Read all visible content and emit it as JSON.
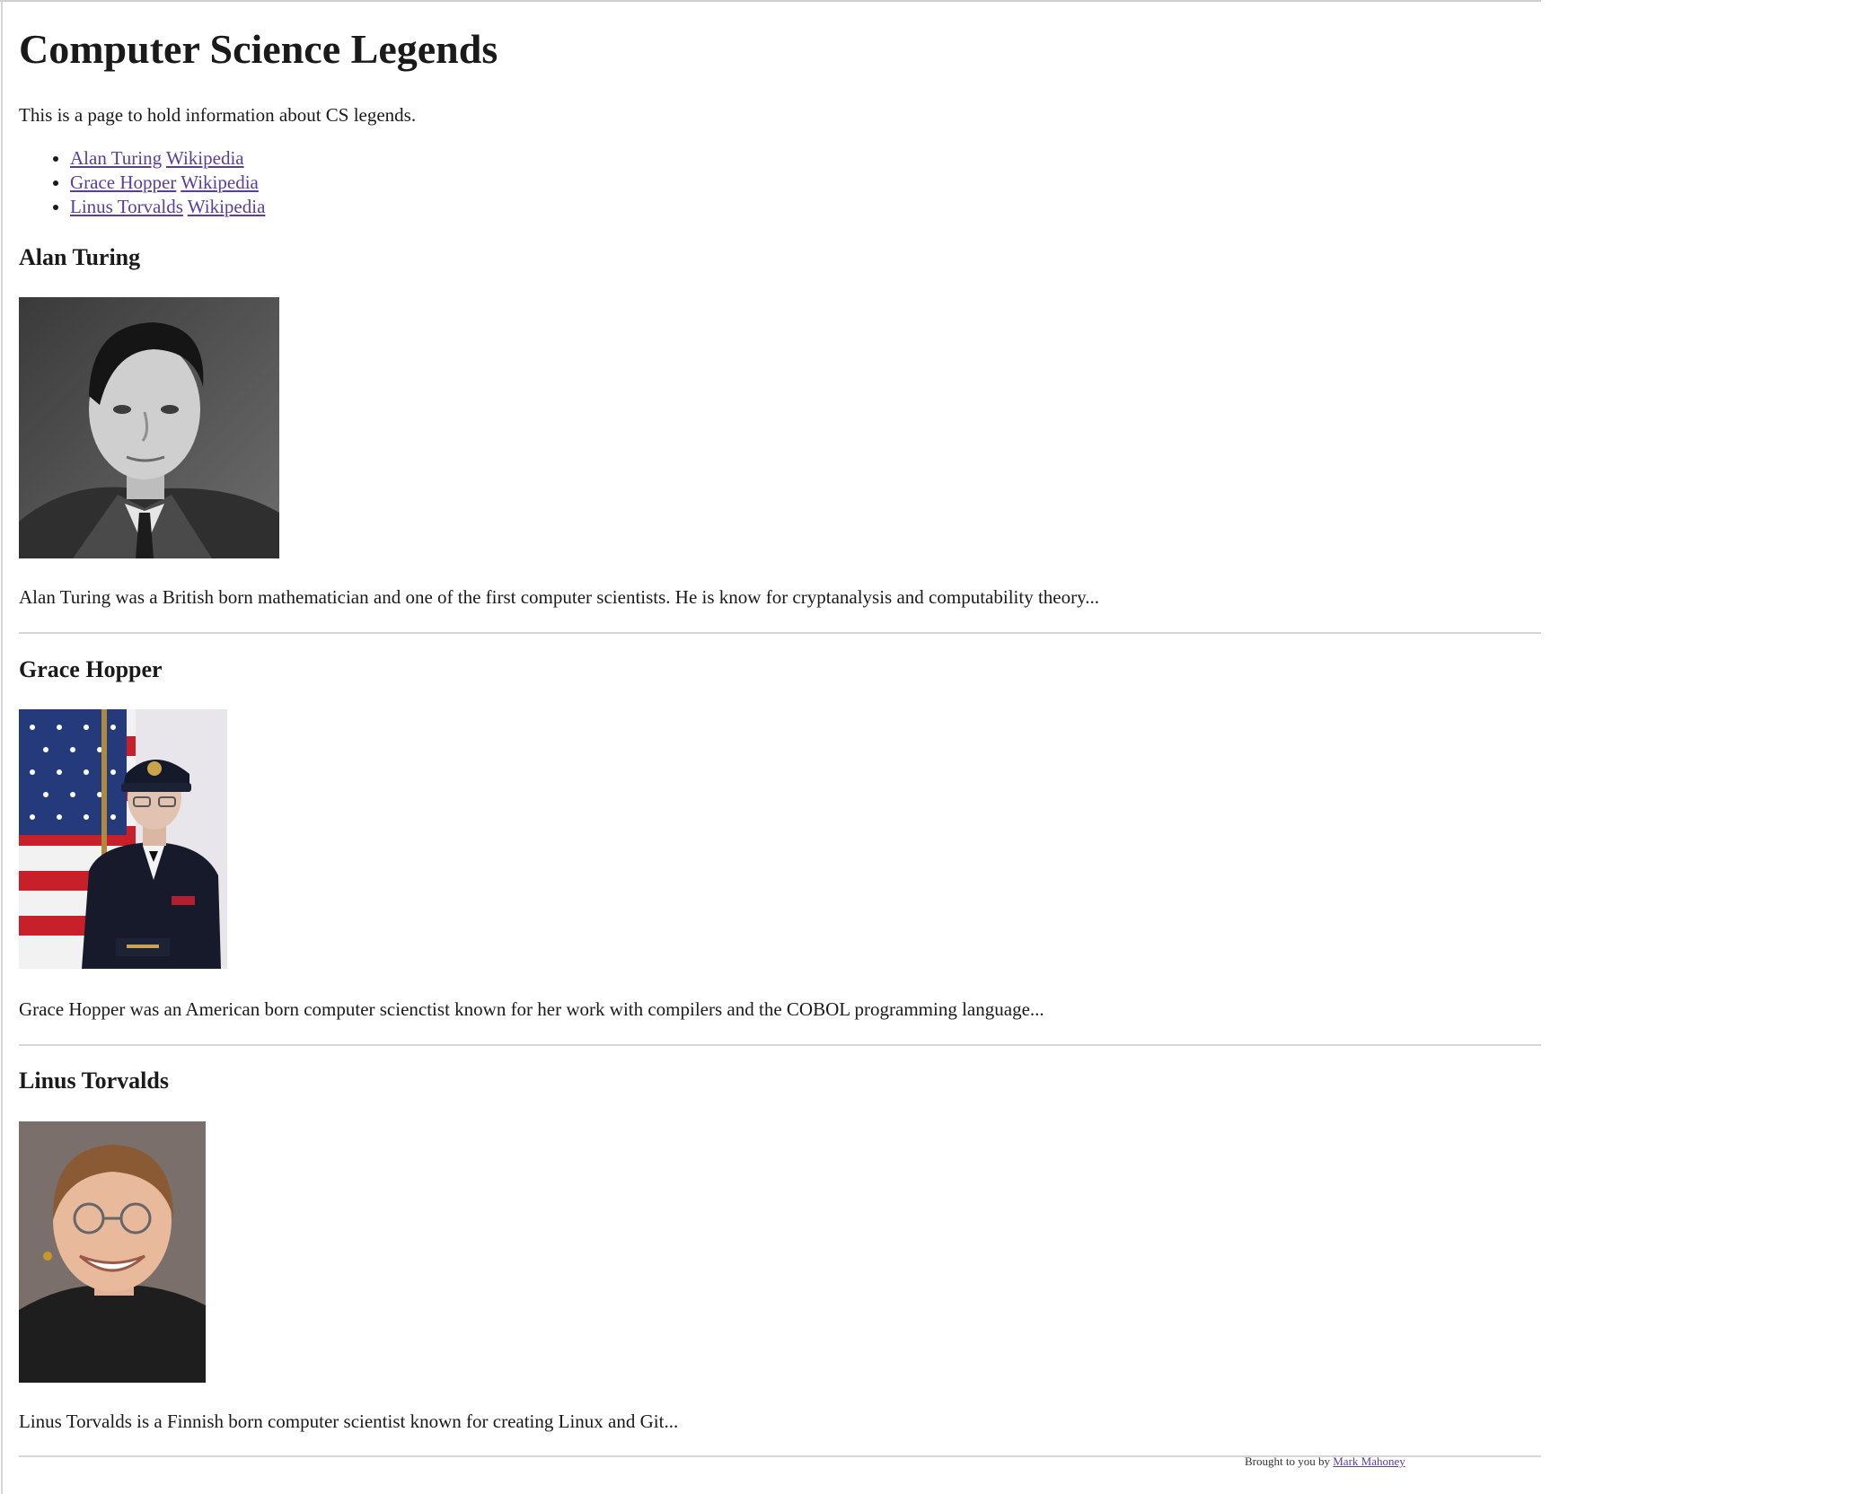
{
  "page": {
    "title": "Computer Science Legends",
    "intro": "This is a page to hold information about CS legends."
  },
  "toc": [
    {
      "name": "Alan Turing",
      "wiki": "Wikipedia"
    },
    {
      "name": "Grace Hopper",
      "wiki": "Wikipedia"
    },
    {
      "name": "Linus Torvalds",
      "wiki": "Wikipedia"
    }
  ],
  "sections": [
    {
      "heading": "Alan Turing",
      "bio": "Alan Turing was a British born mathematician and one of the first computer scientists. He is know for cryptanalysis and computability theory..."
    },
    {
      "heading": "Grace Hopper",
      "bio": "Grace Hopper was an American born computer scienctist known for her work with compilers and the COBOL programming language..."
    },
    {
      "heading": "Linus Torvalds",
      "bio": "Linus Torvalds is a Finnish born computer scientist known for creating Linux and Git..."
    }
  ],
  "footer": {
    "prefix": "Brought to you by",
    "author_link": "Mark Mahoney"
  },
  "colors": {
    "link": "#5a3e9b",
    "rule": "#d6d6d6",
    "text": "#1a1a1a"
  }
}
